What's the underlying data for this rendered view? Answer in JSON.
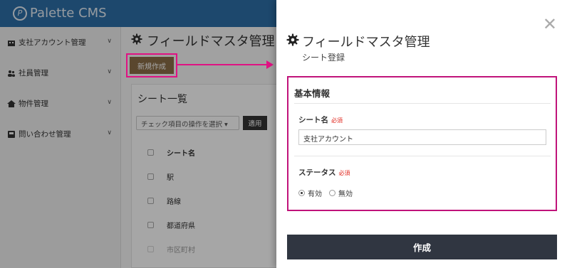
{
  "app": {
    "logo_text": "Palette CMS"
  },
  "sidebar": {
    "items": [
      {
        "label": "支社アカウント管理"
      },
      {
        "label": "社員管理"
      },
      {
        "label": "物件管理"
      },
      {
        "label": "問い合わせ管理"
      }
    ]
  },
  "main": {
    "title": "フィールドマスタ管理",
    "new_button": "新規作成",
    "panel_title": "シート一覧",
    "bulk_select": "チェック項目の操作を選択",
    "apply_button": "適用",
    "table": {
      "header": "シート名",
      "rows": [
        "駅",
        "路線",
        "都道府県",
        "市区町村"
      ]
    }
  },
  "drawer": {
    "title": "フィールドマスタ管理",
    "subtitle": "シート登録",
    "section_title": "基本情報",
    "sheet_name_label": "シート名",
    "required": "必須",
    "sheet_name_value": "支社アカウント",
    "status_label": "ステータス",
    "status_options": [
      "有効",
      "無効"
    ],
    "status_selected": "有効",
    "submit": "作成"
  },
  "colors": {
    "topbar": "#2d6fa8",
    "annotation": "#e01283",
    "new_button": "#8a6d48",
    "submit": "#303641"
  }
}
